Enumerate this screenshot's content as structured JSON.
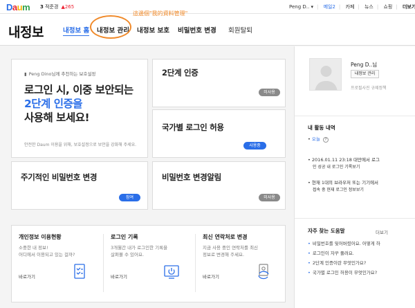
{
  "topbar": {
    "logo": [
      "D",
      "a",
      "u",
      "m"
    ],
    "rank_num": "3",
    "rank_text": "적준경",
    "rank_change": "▲265",
    "user": "Peng D.. ▾",
    "items": [
      "메일2",
      "카페",
      "뉴스",
      "쇼핑"
    ],
    "more": "더보기 ▾"
  },
  "header": {
    "title": "내정보",
    "tabs": [
      "내정보 홈",
      "내정보 관리",
      "내정보 보호",
      "비밀번호 변경",
      "회원탈퇴"
    ]
  },
  "annotation": "這邊個\"我的資料管理\"",
  "hero": {
    "tag": "Peng Dino님께 추천하는 보호설정",
    "line1": "로그인 시, 이중 보안되는",
    "line2": "2단계 인증을",
    "line3": "사용해 보세요!",
    "desc": "안전한 Daum 이용을 위해, 보호설정으로 보안을 강화해 주세요."
  },
  "cards": {
    "two_step": {
      "title": "2단계 인증",
      "desc1": "",
      "desc2": "",
      "status": "미사용"
    },
    "country": {
      "title": "국가별 로그인 허용",
      "desc1": "",
      "desc2": "",
      "status": "사용중"
    },
    "periodic": {
      "title": "주기적인 비밀번호 변경",
      "desc1": "",
      "desc2": "",
      "status": "참여"
    },
    "alert": {
      "title": "비밀번호 변경알림",
      "desc1": "",
      "desc2": "",
      "status": "미사용"
    }
  },
  "bottom": [
    {
      "title": "개인정보 이용현황",
      "desc1": "소중한 내 정보!",
      "desc2": "어디에서 이용되고 있는 걸까?",
      "link": "바로가기",
      "icon": "document-check-icon"
    },
    {
      "title": "로그인 기록",
      "desc1": "3개월간 내가 로그인한 기록을",
      "desc2": "살펴볼 수 있어요.",
      "link": "바로가기",
      "icon": "power-icon"
    },
    {
      "title": "최신 연락처로 변경",
      "desc1": "지금 사용 중인 연락처를 최신",
      "desc2": "정보로 변경해 주세요.",
      "link": "바로가기",
      "icon": "contact-refresh-icon"
    }
  ],
  "profile": {
    "name": "Peng D..님",
    "button": "내정보 관리",
    "sub": "프로필사진 규제정책"
  },
  "activity": {
    "heading": "내 활동 내역",
    "items": [
      {
        "bold": "오늘",
        "text": "",
        "sub": ""
      },
      {
        "bold": "",
        "text": "2016.01.11 23:18 대만에서 로그",
        "sub": "인 성공 내 로그인 기록보기"
      },
      {
        "bold": "",
        "text": "현재 1대의 브라우저 또는 기기에서",
        "sub": "접속 중 현재 로그인 정보보기"
      }
    ]
  },
  "help": {
    "heading": "자주 찾는 도움말",
    "more": "더보기",
    "items": [
      "비밀번호를 잊어버렸어요. 어떻게 하",
      "로그인이 자꾸 풀려요.",
      "2단계 인증이란 무엇인가요?",
      "국가별 로그인 허용이 무엇인가요?"
    ]
  },
  "colors": {
    "accent": "#2a6ee8",
    "annotation": "#f08a2a",
    "pill_gray": "#8a8a8a"
  }
}
